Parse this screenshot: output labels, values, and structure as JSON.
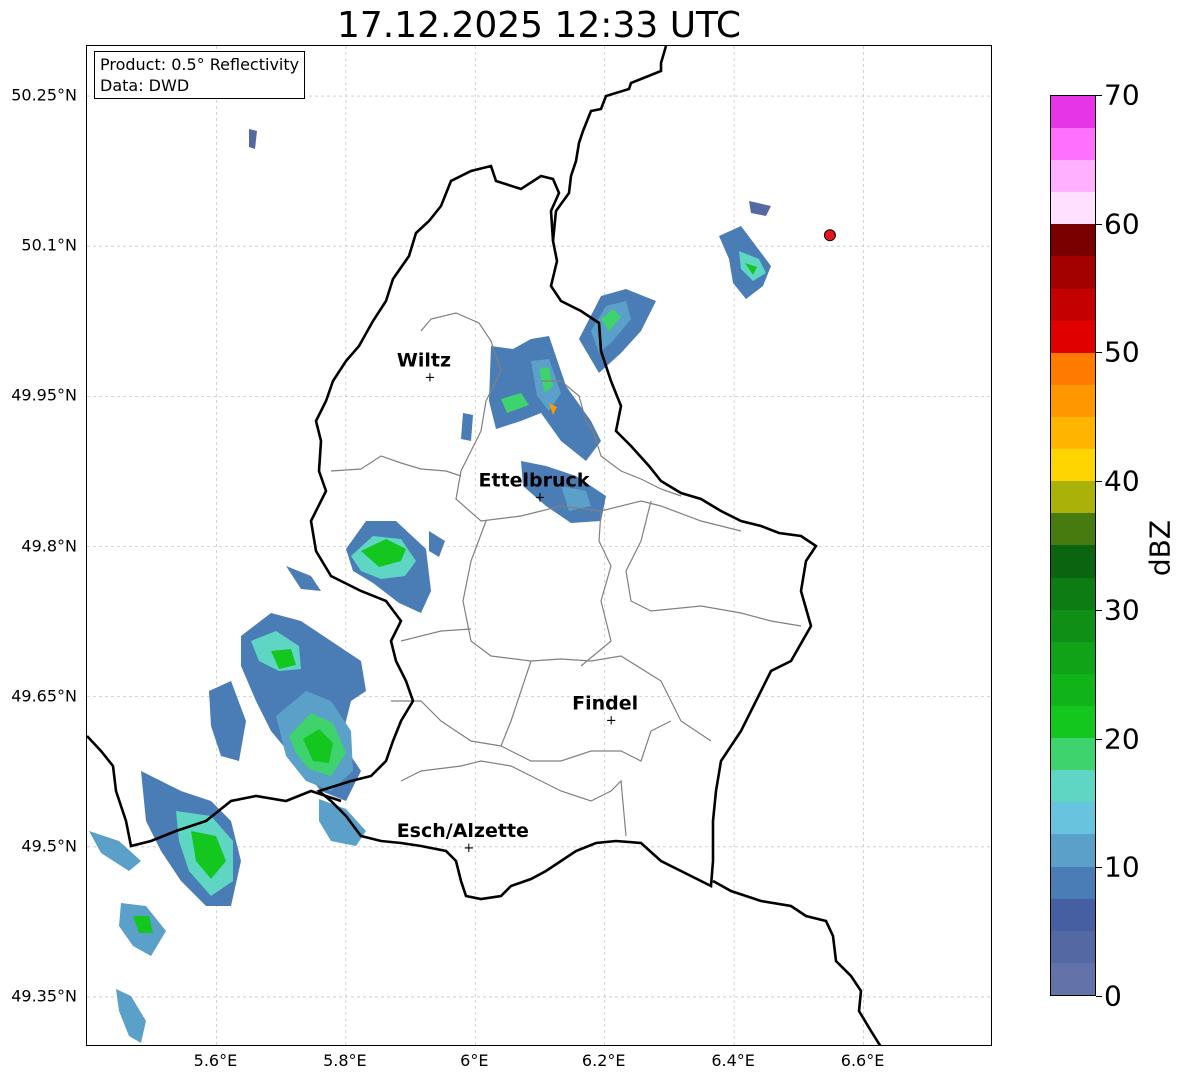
{
  "title": "17.12.2025 12:33 UTC",
  "info": {
    "product": "Product: 0.5° Reflectivity",
    "source": "Data: DWD"
  },
  "map": {
    "lon_range": [
      5.4,
      6.8
    ],
    "lat_range": [
      49.3,
      50.3
    ],
    "lat_ticks": [
      {
        "value": 50.25,
        "label": "50.25°N"
      },
      {
        "value": 50.1,
        "label": "50.1°N"
      },
      {
        "value": 49.95,
        "label": "49.95°N"
      },
      {
        "value": 49.8,
        "label": "49.8°N"
      },
      {
        "value": 49.65,
        "label": "49.65°N"
      },
      {
        "value": 49.5,
        "label": "49.5°N"
      },
      {
        "value": 49.35,
        "label": "49.35°N"
      }
    ],
    "lon_ticks": [
      {
        "value": 5.6,
        "label": "5.6°E"
      },
      {
        "value": 5.8,
        "label": "5.8°E"
      },
      {
        "value": 6.0,
        "label": "6°E"
      },
      {
        "value": 6.2,
        "label": "6.2°E"
      },
      {
        "value": 6.4,
        "label": "6.4°E"
      },
      {
        "value": 6.6,
        "label": "6.6°E"
      }
    ],
    "cities": [
      {
        "name": "Wiltz",
        "lon": 5.93,
        "lat": 49.97
      },
      {
        "name": "Ettelbruck",
        "lon": 6.1,
        "lat": 49.85
      },
      {
        "name": "Findel",
        "lon": 6.21,
        "lat": 49.627
      },
      {
        "name": "Esch/Alzette",
        "lon": 5.99,
        "lat": 49.5
      }
    ],
    "radar_site": {
      "lon": 6.548,
      "lat": 50.111,
      "color": "#e8141b"
    }
  },
  "colorbar": {
    "label": "dBZ",
    "min": 0,
    "max": 70,
    "ticks": [
      "0",
      "10",
      "20",
      "30",
      "40",
      "50",
      "60",
      "70"
    ],
    "colors": [
      "#6372a8",
      "#5468a3",
      "#455fa2",
      "#4a7cb6",
      "#5aa0c8",
      "#68c3df",
      "#5fd6c4",
      "#3ed36c",
      "#13c71f",
      "#10b418",
      "#10a217",
      "#0f8f16",
      "#0c7c13",
      "#0a6410",
      "#477a0f",
      "#aab20a",
      "#ffd500",
      "#ffb400",
      "#ff9800",
      "#ff7b00",
      "#e00000",
      "#c50000",
      "#a30000",
      "#7a0000",
      "#ffe0ff",
      "#ffb0ff",
      "#ff70ff",
      "#e635e6"
    ]
  }
}
